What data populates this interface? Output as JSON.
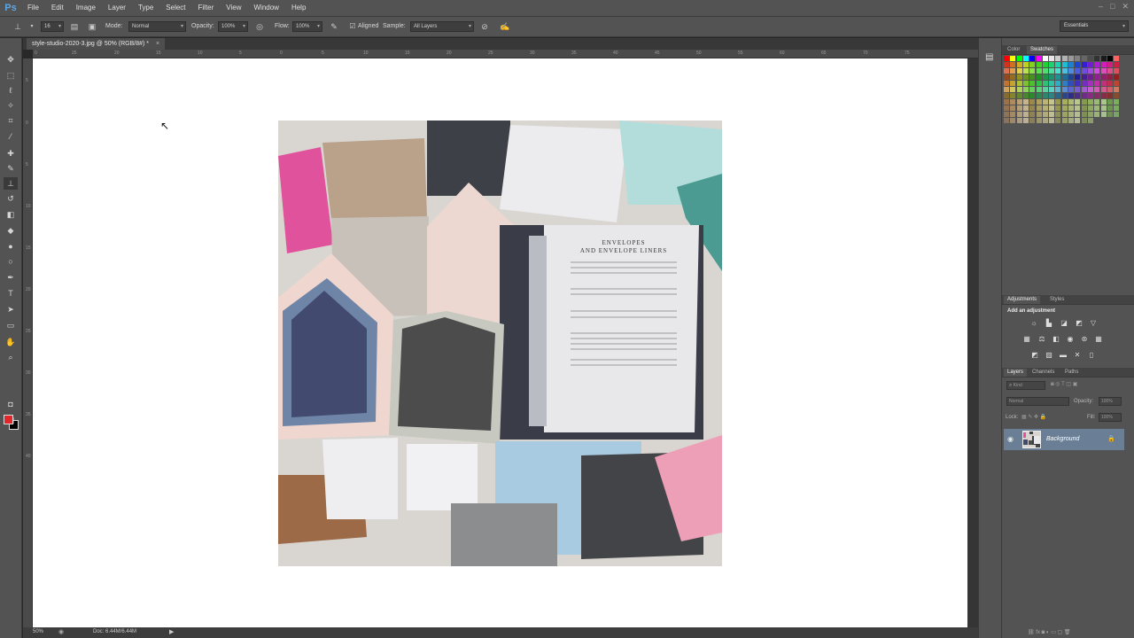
{
  "app": {
    "logo": "Ps"
  },
  "menu": [
    "File",
    "Edit",
    "Image",
    "Layer",
    "Type",
    "Select",
    "Filter",
    "View",
    "Window",
    "Help"
  ],
  "window_controls": {
    "minimize": "–",
    "restore": "□",
    "close": "✕"
  },
  "options_bar": {
    "brush_size": "16",
    "mode_label": "Mode:",
    "mode_value": "Normal",
    "opacity_label": "Opacity:",
    "opacity_value": "100%",
    "flow_label": "Flow:",
    "flow_value": "100%",
    "aligned_label": "Aligned",
    "aligned_checked": true,
    "sample_label": "Sample:",
    "sample_value": "All Layers"
  },
  "workspace": "Essentials",
  "document": {
    "tab_title": "style-studio-2020-3.jpg @ 50% (RGB/8#) *",
    "close": "×"
  },
  "rulers": {
    "top": [
      "0",
      "25",
      "20",
      "15",
      "10",
      "5",
      "0",
      "5",
      "10",
      "15",
      "20",
      "25",
      "30",
      "35",
      "40",
      "45",
      "50",
      "55",
      "60",
      "65",
      "70",
      "75"
    ],
    "left": [
      "5",
      "0",
      "5",
      "10",
      "15",
      "20",
      "25",
      "30",
      "35",
      "40"
    ]
  },
  "statusbar": {
    "zoom": "50%",
    "doc_info": "Doc: 6.44M/6.44M"
  },
  "color_panel": {
    "tabs": [
      "Color",
      "Swatches"
    ],
    "active": "Swatches"
  },
  "adjustments_panel": {
    "tabs": [
      "Adjustments",
      "Styles"
    ],
    "active": "Adjustments",
    "heading": "Add an adjustment"
  },
  "layers_panel": {
    "tabs": [
      "Layers",
      "Channels",
      "Paths"
    ],
    "active": "Layers",
    "kind_filter": "Kind",
    "blend_mode": "Normal",
    "opacity_label": "Opacity:",
    "opacity_value": "100%",
    "lock_label": "Lock:",
    "fill_label": "Fill:",
    "fill_value": "100%",
    "layers": [
      {
        "name": "Background",
        "visible": true,
        "locked": true
      }
    ]
  },
  "photo_text": {
    "title_line1": "ENVELOPES",
    "title_line2": "AND ENVELOPE LINERS"
  },
  "colors": {
    "foreground": "#e3262a",
    "background": "#000000",
    "ui_panel": "#535353"
  }
}
